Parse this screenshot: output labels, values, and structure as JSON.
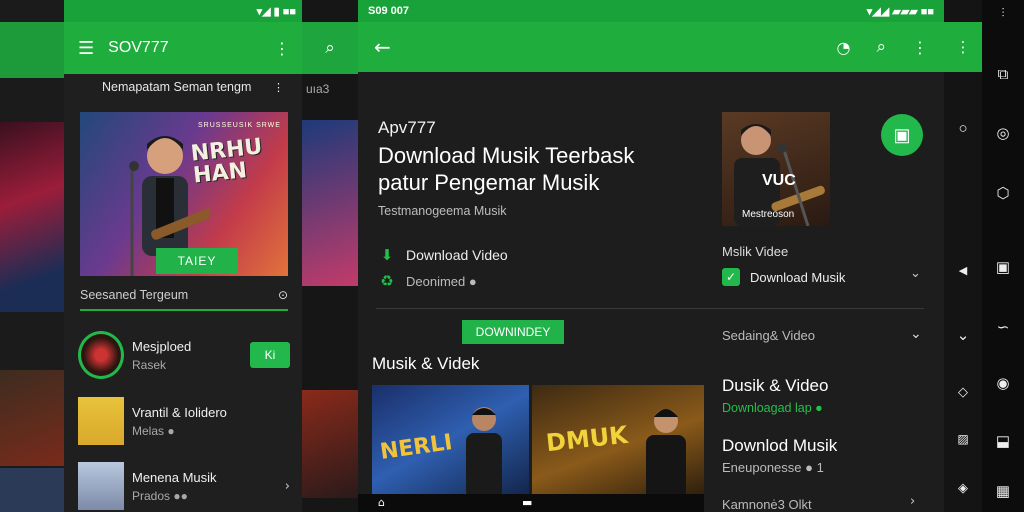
{
  "colors": {
    "accent": "#1fae3e",
    "background": "#1d1d1d"
  },
  "phone1": {
    "status_icons": "▾◢ ▮ ■■",
    "appbar": {
      "title": "SOV777",
      "menu_icon": "hamburger-icon",
      "more_icon": "more-vert-icon"
    },
    "search_text": "Nemapatam Seman tengm",
    "hero": {
      "poster_text": "NRHU\nHAN",
      "tag": "SRUSSEUSIK SRWE",
      "button": "TAIEY"
    },
    "section_title": "Seesaned Tergeum",
    "rows": [
      {
        "title": "Mesjploed",
        "subtitle": "Rasek",
        "action": "Ki"
      },
      {
        "title": "Vrantil & Iolidero",
        "subtitle": "Melas ●"
      },
      {
        "title": "Menena Musik",
        "subtitle": "Prados ●●"
      }
    ]
  },
  "strip": {
    "text": "uıa3"
  },
  "phone2": {
    "status_left": "S09 007",
    "status_right": "▾◢◢ ▰▰▰ ■■",
    "header": {
      "small": "Apv777",
      "line1": "Download Musik Teerbask",
      "line2": "patur Pengemar Musik",
      "sub": "Testmanogeema Musik"
    },
    "download_video": "Download Video",
    "deonimed": "Deonimed ●",
    "thumb_caption": "Mestreoson",
    "poster_word": "VUC",
    "right_items": {
      "video": "Mslik Videe",
      "download_musik": "Download Musik",
      "sharing": "Sedaing& Video"
    },
    "download_button": "DOWNINDEY",
    "section": "Musik & Videk",
    "cards": [
      {
        "text": "NERLI"
      },
      {
        "text": "DMUK"
      }
    ],
    "right_list": [
      {
        "title": "Dusik & Video",
        "sub": "Downloagad lap ●"
      },
      {
        "title": "Downlod Musik",
        "sub": "Eneuponesse ● 1"
      },
      {
        "title": "",
        "sub": "Kamnonė3 Olkt"
      }
    ]
  }
}
